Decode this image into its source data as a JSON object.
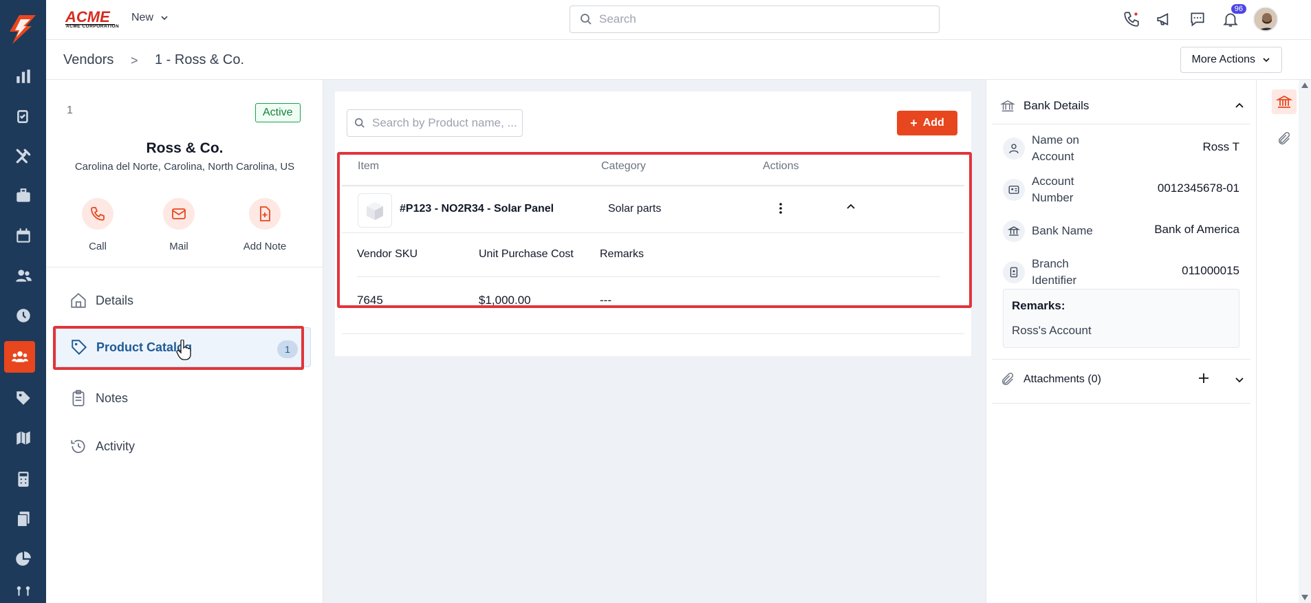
{
  "topbar": {
    "brand": "ACME CORPORATION",
    "new_label": "New",
    "search_placeholder": "Search",
    "notification_count": "96"
  },
  "breadcrumb": {
    "root": "Vendors",
    "separator": ">",
    "current": "1 - Ross & Co."
  },
  "more_actions_label": "More Actions",
  "vendor": {
    "id": "1",
    "status": "Active",
    "name": "Ross & Co.",
    "address": "Carolina del Norte, Carolina, North Carolina, US"
  },
  "quick_actions": {
    "call": "Call",
    "mail": "Mail",
    "add_note": "Add Note"
  },
  "nav": {
    "details": "Details",
    "product_catalog": "Product Catalog",
    "product_catalog_count": "1",
    "notes": "Notes",
    "activity": "Activity"
  },
  "catalog": {
    "search_placeholder": "Search by Product name, ...",
    "add_label": "Add",
    "columns": {
      "item": "Item",
      "category": "Category",
      "actions": "Actions"
    },
    "products": [
      {
        "name": "#P123 - NO2R34 - Solar Panel",
        "category": "Solar parts",
        "detail_columns": {
          "sku": "Vendor SKU",
          "cost": "Unit Purchase Cost",
          "remarks": "Remarks"
        },
        "vendor_sku": "7645",
        "unit_purchase_cost": "$1,000.00",
        "remarks": "---"
      }
    ]
  },
  "bank": {
    "title": "Bank Details",
    "rows": [
      {
        "label": "Name on Account",
        "value": "Ross T",
        "icon": "user-icon"
      },
      {
        "label": "Account Number",
        "value": "0012345678-01",
        "icon": "id-card-icon"
      },
      {
        "label": "Bank Name",
        "value": "Bank of America",
        "icon": "bank-icon"
      },
      {
        "label": "Branch Identifier",
        "value": "011000015",
        "icon": "badge-icon"
      }
    ],
    "remarks_label": "Remarks:",
    "remarks_value": "Ross's Account"
  },
  "attachments": {
    "title": "Attachments (0)"
  },
  "colors": {
    "accent": "#e8461e",
    "rail": "#1d3a5a",
    "selected_nav": "#1e5a96",
    "highlight": "#e0353b"
  }
}
